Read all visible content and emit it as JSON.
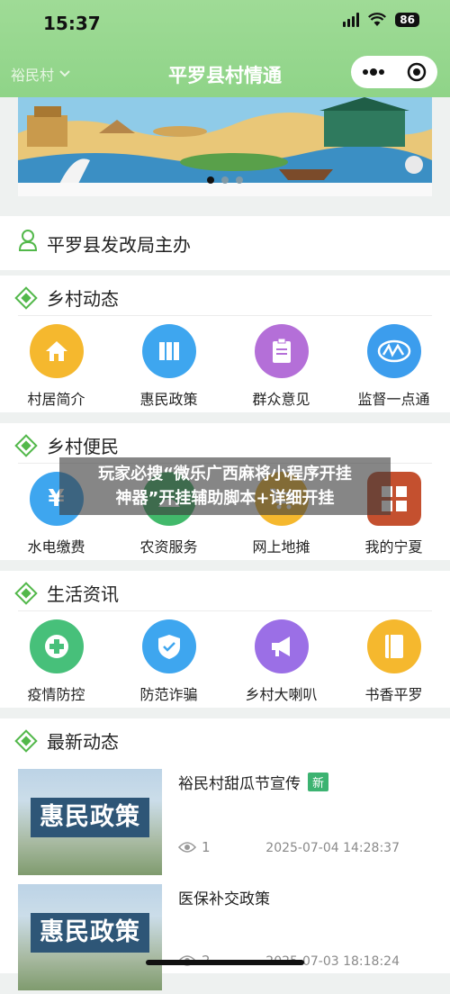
{
  "status_bar": {
    "time": "15:37",
    "battery": "86"
  },
  "nav": {
    "left": "裕民村",
    "title": "平罗县村情通"
  },
  "sponsor": {
    "text": "平罗县发改局主办"
  },
  "overlay": {
    "line1": "玩家必搜“微乐广西麻将小程序开挂",
    "line2": "神器”开挂辅助脚本+详细开挂"
  },
  "sections": [
    {
      "title": "乡村动态",
      "items": [
        {
          "label": "村居简介",
          "icon": "house-icon",
          "color": "#f5b82e"
        },
        {
          "label": "惠民政策",
          "icon": "books-icon",
          "color": "#3ea6ef"
        },
        {
          "label": "群众意见",
          "icon": "clipboard-icon",
          "color": "#b46fd8"
        },
        {
          "label": "监督一点通",
          "icon": "monitor-logo-icon",
          "color": "#3c9ded"
        }
      ]
    },
    {
      "title": "乡村便民",
      "items": [
        {
          "label": "水电缴费",
          "icon": "yen-icon",
          "color": "#3ea6ef"
        },
        {
          "label": "农资服务",
          "icon": "farm-icon",
          "color": "#42b96b"
        },
        {
          "label": "网上地摊",
          "icon": "cart-icon",
          "color": "#f5b82e"
        },
        {
          "label": "我的宁夏",
          "icon": "ningxia-logo-icon",
          "color": "#c4502f"
        }
      ]
    },
    {
      "title": "生活资讯",
      "items": [
        {
          "label": "疫情防控",
          "icon": "plus-icon",
          "color": "#47c07a"
        },
        {
          "label": "防范诈骗",
          "icon": "shield-icon",
          "color": "#3ea6ef"
        },
        {
          "label": "乡村大喇叭",
          "icon": "megaphone-icon",
          "color": "#9b6fe6"
        },
        {
          "label": "书香平罗",
          "icon": "book-icon",
          "color": "#f5b82e"
        }
      ]
    }
  ],
  "news": {
    "title": "最新动态",
    "items": [
      {
        "title": "裕民村甜瓜节宣传",
        "badge": "新",
        "views": "1",
        "date": "2025-07-04 14:28:37",
        "thumb_text": "惠民政策"
      },
      {
        "title": "医保补交政策",
        "badge": "",
        "views": "2",
        "date": "2025-07-03 18:18:24",
        "thumb_text": "惠民政策"
      }
    ]
  }
}
